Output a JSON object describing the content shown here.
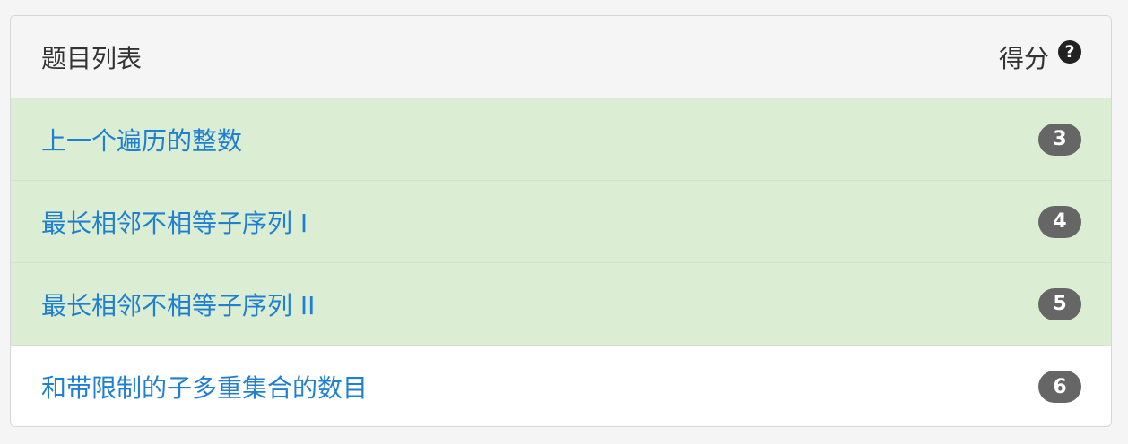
{
  "header": {
    "title": "题目列表",
    "score_label": "得分",
    "help_icon": "?"
  },
  "problems": [
    {
      "title": "上一个遍历的整数",
      "score": "3",
      "solved": true
    },
    {
      "title": "最长相邻不相等子序列 I",
      "score": "4",
      "solved": true
    },
    {
      "title": "最长相邻不相等子序列 II",
      "score": "5",
      "solved": true
    },
    {
      "title": "和带限制的子多重集合的数目",
      "score": "6",
      "solved": false
    }
  ],
  "colors": {
    "solved_row": "#dbeed3",
    "link": "#1f7fd1",
    "badge": "#666666"
  }
}
